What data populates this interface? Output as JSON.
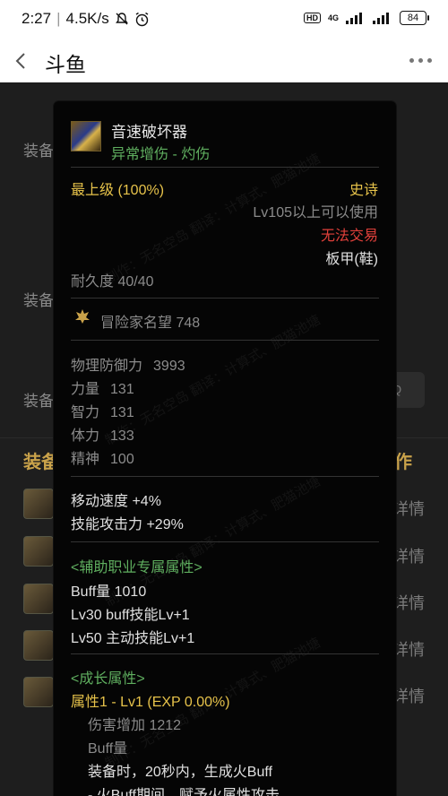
{
  "status_bar": {
    "time": "2:27",
    "speed": "4.5K/s",
    "hd": "HD",
    "network": "4G",
    "battery": "84"
  },
  "nav": {
    "title": "斗鱼"
  },
  "background": {
    "labels": [
      "装备",
      "装备",
      "装备"
    ],
    "section_title": "装备",
    "section_action": "作",
    "search_hint": "Q",
    "row_action": "详情"
  },
  "item": {
    "name": "音速破坏器",
    "subtitle": "异常增伤 - 灼伤",
    "grade": "最上级 (100%)",
    "rarity": "史诗",
    "level_req": "Lv105以上可以使用",
    "trade": "无法交易",
    "slot": "板甲(鞋)",
    "durability": "耐久度 40/40",
    "fame": "冒险家名望 748",
    "stats": [
      {
        "name": "物理防御力",
        "value": "3993"
      },
      {
        "name": "力量",
        "value": "131"
      },
      {
        "name": "智力",
        "value": "131"
      },
      {
        "name": "体力",
        "value": "133"
      },
      {
        "name": "精神",
        "value": "100"
      }
    ],
    "move_speed": "移动速度  +4%",
    "skill_attack": "技能攻击力  +29%",
    "support_header": "<辅助职业专属属性>",
    "buff_amount": "Buff量  1010",
    "lv30": "Lv30 buff技能Lv+1",
    "lv50": "Lv50 主动技能Lv+1",
    "growth_header": "<成长属性>",
    "attr1": "属性1 - Lv1 (EXP 0.00%)",
    "damage_inc": "伤害增加  1212",
    "buff_label": "Buff量",
    "desc1": "装备时，20秒内，生成火Buff",
    "desc2": "- 火Buff期间，赋予火属性攻击"
  },
  "watermark": "制作：无名空岛  翻译：计算式、肥猫池塘",
  "colors": {
    "gold": "#e6c24a",
    "green": "#5fae5f",
    "red": "#e0403a",
    "grey": "#8a8a8a",
    "card_bg": "#050505"
  }
}
